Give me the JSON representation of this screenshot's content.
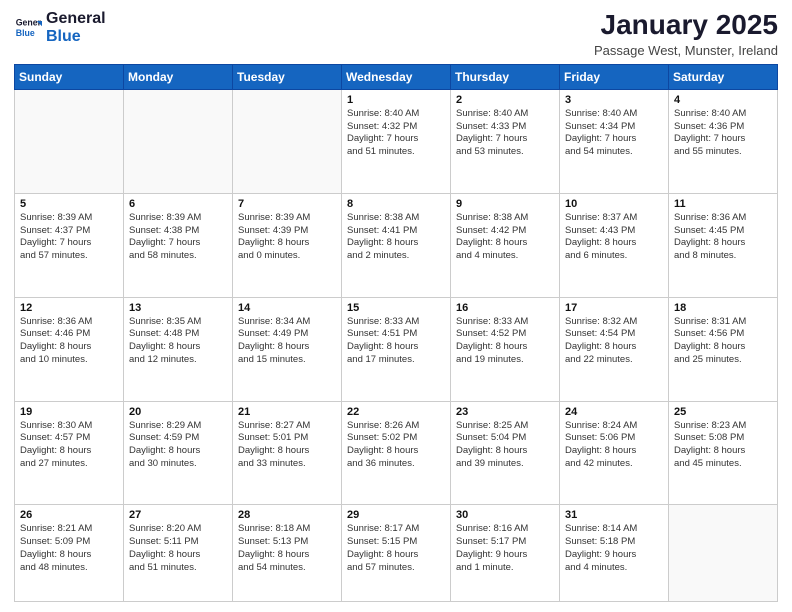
{
  "header": {
    "logo_general": "General",
    "logo_blue": "Blue",
    "month": "January 2025",
    "location": "Passage West, Munster, Ireland"
  },
  "days_of_week": [
    "Sunday",
    "Monday",
    "Tuesday",
    "Wednesday",
    "Thursday",
    "Friday",
    "Saturday"
  ],
  "weeks": [
    [
      {
        "day": "",
        "info": ""
      },
      {
        "day": "",
        "info": ""
      },
      {
        "day": "",
        "info": ""
      },
      {
        "day": "1",
        "info": "Sunrise: 8:40 AM\nSunset: 4:32 PM\nDaylight: 7 hours\nand 51 minutes."
      },
      {
        "day": "2",
        "info": "Sunrise: 8:40 AM\nSunset: 4:33 PM\nDaylight: 7 hours\nand 53 minutes."
      },
      {
        "day": "3",
        "info": "Sunrise: 8:40 AM\nSunset: 4:34 PM\nDaylight: 7 hours\nand 54 minutes."
      },
      {
        "day": "4",
        "info": "Sunrise: 8:40 AM\nSunset: 4:36 PM\nDaylight: 7 hours\nand 55 minutes."
      }
    ],
    [
      {
        "day": "5",
        "info": "Sunrise: 8:39 AM\nSunset: 4:37 PM\nDaylight: 7 hours\nand 57 minutes."
      },
      {
        "day": "6",
        "info": "Sunrise: 8:39 AM\nSunset: 4:38 PM\nDaylight: 7 hours\nand 58 minutes."
      },
      {
        "day": "7",
        "info": "Sunrise: 8:39 AM\nSunset: 4:39 PM\nDaylight: 8 hours\nand 0 minutes."
      },
      {
        "day": "8",
        "info": "Sunrise: 8:38 AM\nSunset: 4:41 PM\nDaylight: 8 hours\nand 2 minutes."
      },
      {
        "day": "9",
        "info": "Sunrise: 8:38 AM\nSunset: 4:42 PM\nDaylight: 8 hours\nand 4 minutes."
      },
      {
        "day": "10",
        "info": "Sunrise: 8:37 AM\nSunset: 4:43 PM\nDaylight: 8 hours\nand 6 minutes."
      },
      {
        "day": "11",
        "info": "Sunrise: 8:36 AM\nSunset: 4:45 PM\nDaylight: 8 hours\nand 8 minutes."
      }
    ],
    [
      {
        "day": "12",
        "info": "Sunrise: 8:36 AM\nSunset: 4:46 PM\nDaylight: 8 hours\nand 10 minutes."
      },
      {
        "day": "13",
        "info": "Sunrise: 8:35 AM\nSunset: 4:48 PM\nDaylight: 8 hours\nand 12 minutes."
      },
      {
        "day": "14",
        "info": "Sunrise: 8:34 AM\nSunset: 4:49 PM\nDaylight: 8 hours\nand 15 minutes."
      },
      {
        "day": "15",
        "info": "Sunrise: 8:33 AM\nSunset: 4:51 PM\nDaylight: 8 hours\nand 17 minutes."
      },
      {
        "day": "16",
        "info": "Sunrise: 8:33 AM\nSunset: 4:52 PM\nDaylight: 8 hours\nand 19 minutes."
      },
      {
        "day": "17",
        "info": "Sunrise: 8:32 AM\nSunset: 4:54 PM\nDaylight: 8 hours\nand 22 minutes."
      },
      {
        "day": "18",
        "info": "Sunrise: 8:31 AM\nSunset: 4:56 PM\nDaylight: 8 hours\nand 25 minutes."
      }
    ],
    [
      {
        "day": "19",
        "info": "Sunrise: 8:30 AM\nSunset: 4:57 PM\nDaylight: 8 hours\nand 27 minutes."
      },
      {
        "day": "20",
        "info": "Sunrise: 8:29 AM\nSunset: 4:59 PM\nDaylight: 8 hours\nand 30 minutes."
      },
      {
        "day": "21",
        "info": "Sunrise: 8:27 AM\nSunset: 5:01 PM\nDaylight: 8 hours\nand 33 minutes."
      },
      {
        "day": "22",
        "info": "Sunrise: 8:26 AM\nSunset: 5:02 PM\nDaylight: 8 hours\nand 36 minutes."
      },
      {
        "day": "23",
        "info": "Sunrise: 8:25 AM\nSunset: 5:04 PM\nDaylight: 8 hours\nand 39 minutes."
      },
      {
        "day": "24",
        "info": "Sunrise: 8:24 AM\nSunset: 5:06 PM\nDaylight: 8 hours\nand 42 minutes."
      },
      {
        "day": "25",
        "info": "Sunrise: 8:23 AM\nSunset: 5:08 PM\nDaylight: 8 hours\nand 45 minutes."
      }
    ],
    [
      {
        "day": "26",
        "info": "Sunrise: 8:21 AM\nSunset: 5:09 PM\nDaylight: 8 hours\nand 48 minutes."
      },
      {
        "day": "27",
        "info": "Sunrise: 8:20 AM\nSunset: 5:11 PM\nDaylight: 8 hours\nand 51 minutes."
      },
      {
        "day": "28",
        "info": "Sunrise: 8:18 AM\nSunset: 5:13 PM\nDaylight: 8 hours\nand 54 minutes."
      },
      {
        "day": "29",
        "info": "Sunrise: 8:17 AM\nSunset: 5:15 PM\nDaylight: 8 hours\nand 57 minutes."
      },
      {
        "day": "30",
        "info": "Sunrise: 8:16 AM\nSunset: 5:17 PM\nDaylight: 9 hours\nand 1 minute."
      },
      {
        "day": "31",
        "info": "Sunrise: 8:14 AM\nSunset: 5:18 PM\nDaylight: 9 hours\nand 4 minutes."
      },
      {
        "day": "",
        "info": ""
      }
    ]
  ]
}
